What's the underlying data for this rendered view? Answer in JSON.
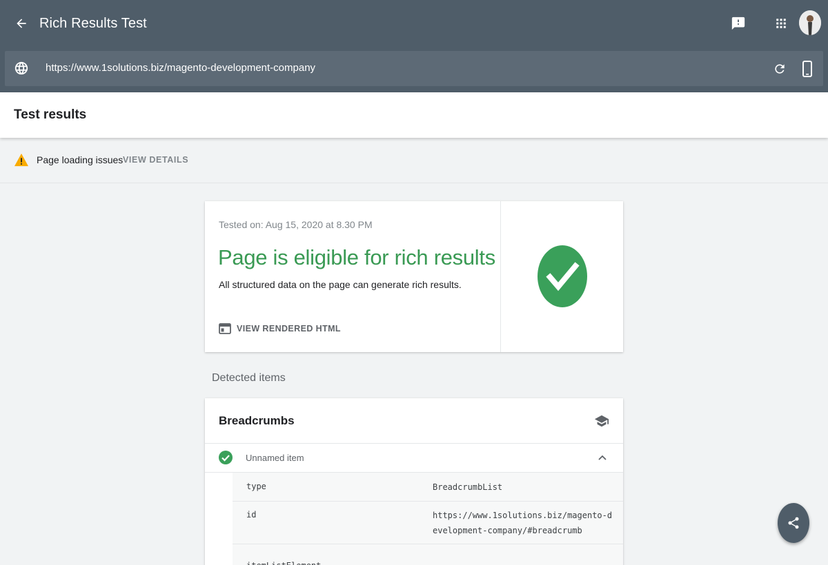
{
  "app": {
    "title": "Rich Results Test",
    "back_icon": "arrow-back-icon",
    "feedback_icon": "feedback-icon",
    "apps_icon": "apps-grid-icon",
    "avatar_icon": "user-avatar"
  },
  "url_bar": {
    "url": "https://www.1solutions.biz/magento-development-company",
    "globe_icon": "globe-icon",
    "refresh_icon": "refresh-icon",
    "device_icon": "smartphone-icon"
  },
  "results": {
    "title": "Test results"
  },
  "warning": {
    "text": "Page loading issues",
    "action": "VIEW DETAILS",
    "icon": "warning-icon"
  },
  "summary": {
    "tested_on": "Tested on: Aug 15, 2020 at 8.30 PM",
    "heading": "Page is eligible for rich results",
    "description": "All structured data on the page can generate rich results.",
    "view_html_label": "VIEW RENDERED HTML",
    "view_html_icon": "web-page-icon",
    "status_icon": "check-circle-icon"
  },
  "detected": {
    "label": "Detected items",
    "card_title": "Breadcrumbs",
    "learn_icon": "school-icon",
    "item_name": "Unnamed item",
    "properties": [
      {
        "key": "type",
        "value": "BreadcrumbList"
      },
      {
        "key": "id",
        "value": "https://www.1solutions.biz/magento-development-company/#breadcrumb"
      },
      {
        "key": "itemListElement",
        "value": ""
      }
    ]
  },
  "fab": {
    "icon": "share-icon"
  },
  "colors": {
    "header_bg": "#4f5d69",
    "url_bg": "#5d6a76",
    "success_green": "#3a9a54",
    "check_fill": "#3aa05a",
    "warning_yellow": "#f9ab00",
    "page_bg": "#f1f3f4"
  }
}
